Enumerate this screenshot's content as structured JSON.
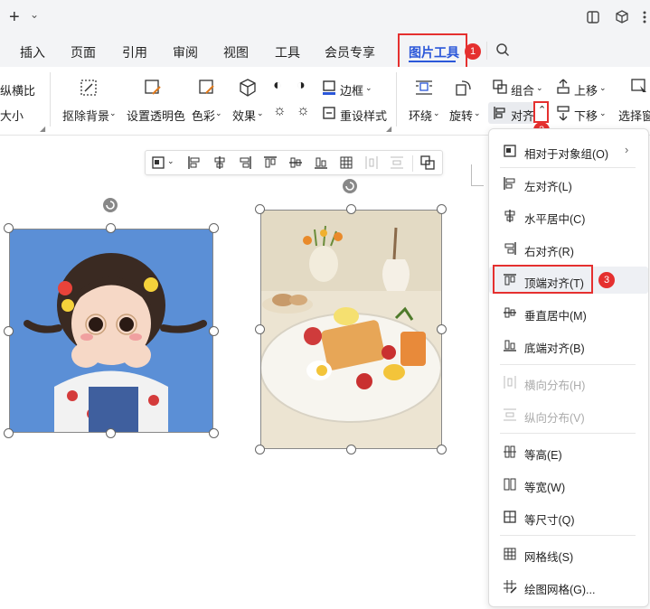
{
  "titlebar": {
    "new_symbol": "+",
    "chevron": "⌄"
  },
  "tabs": [
    {
      "label": "插入"
    },
    {
      "label": "页面"
    },
    {
      "label": "引用"
    },
    {
      "label": "审阅"
    },
    {
      "label": "视图"
    },
    {
      "label": "工具"
    },
    {
      "label": "会员专享"
    },
    {
      "label": "图片工具"
    }
  ],
  "ribbon": {
    "lock_ratio": "纵横比",
    "size": "大小",
    "remove_bg": "抠除背景",
    "transparent": "设置透明色",
    "color": "色彩",
    "effects": "效果",
    "border": "边框",
    "reset": "重设样式",
    "wrap": "环绕",
    "rotate": "旋转",
    "group": "组合",
    "align": "对齐",
    "up": "上移",
    "down": "下移",
    "select_pane": "选择窗"
  },
  "menu": {
    "items": [
      {
        "label": "相对于对象组(O)",
        "icon": "group-relative-icon",
        "disabled": false
      },
      {
        "label": "左对齐(L)",
        "icon": "align-left-icon",
        "disabled": false
      },
      {
        "label": "水平居中(C)",
        "icon": "align-center-h-icon",
        "disabled": false
      },
      {
        "label": "右对齐(R)",
        "icon": "align-right-icon",
        "disabled": false
      },
      {
        "label": "顶端对齐(T)",
        "icon": "align-top-icon",
        "disabled": false
      },
      {
        "label": "垂直居中(M)",
        "icon": "align-middle-icon",
        "disabled": false
      },
      {
        "label": "底端对齐(B)",
        "icon": "align-bottom-icon",
        "disabled": false
      },
      {
        "label": "横向分布(H)",
        "icon": "distribute-h-icon",
        "disabled": true
      },
      {
        "label": "纵向分布(V)",
        "icon": "distribute-v-icon",
        "disabled": true
      },
      {
        "label": "等高(E)",
        "icon": "same-height-icon",
        "disabled": false
      },
      {
        "label": "等宽(W)",
        "icon": "same-width-icon",
        "disabled": false
      },
      {
        "label": "等尺寸(Q)",
        "icon": "same-size-icon",
        "disabled": false
      },
      {
        "label": "网格线(S)",
        "icon": "gridlines-icon",
        "disabled": false
      },
      {
        "label": "绘图网格(G)...",
        "icon": "draw-grid-icon",
        "disabled": false
      }
    ]
  },
  "steps": [
    "1",
    "2",
    "3"
  ],
  "colors": {
    "accent": "#2b57d9",
    "highlight": "#e5302f"
  }
}
